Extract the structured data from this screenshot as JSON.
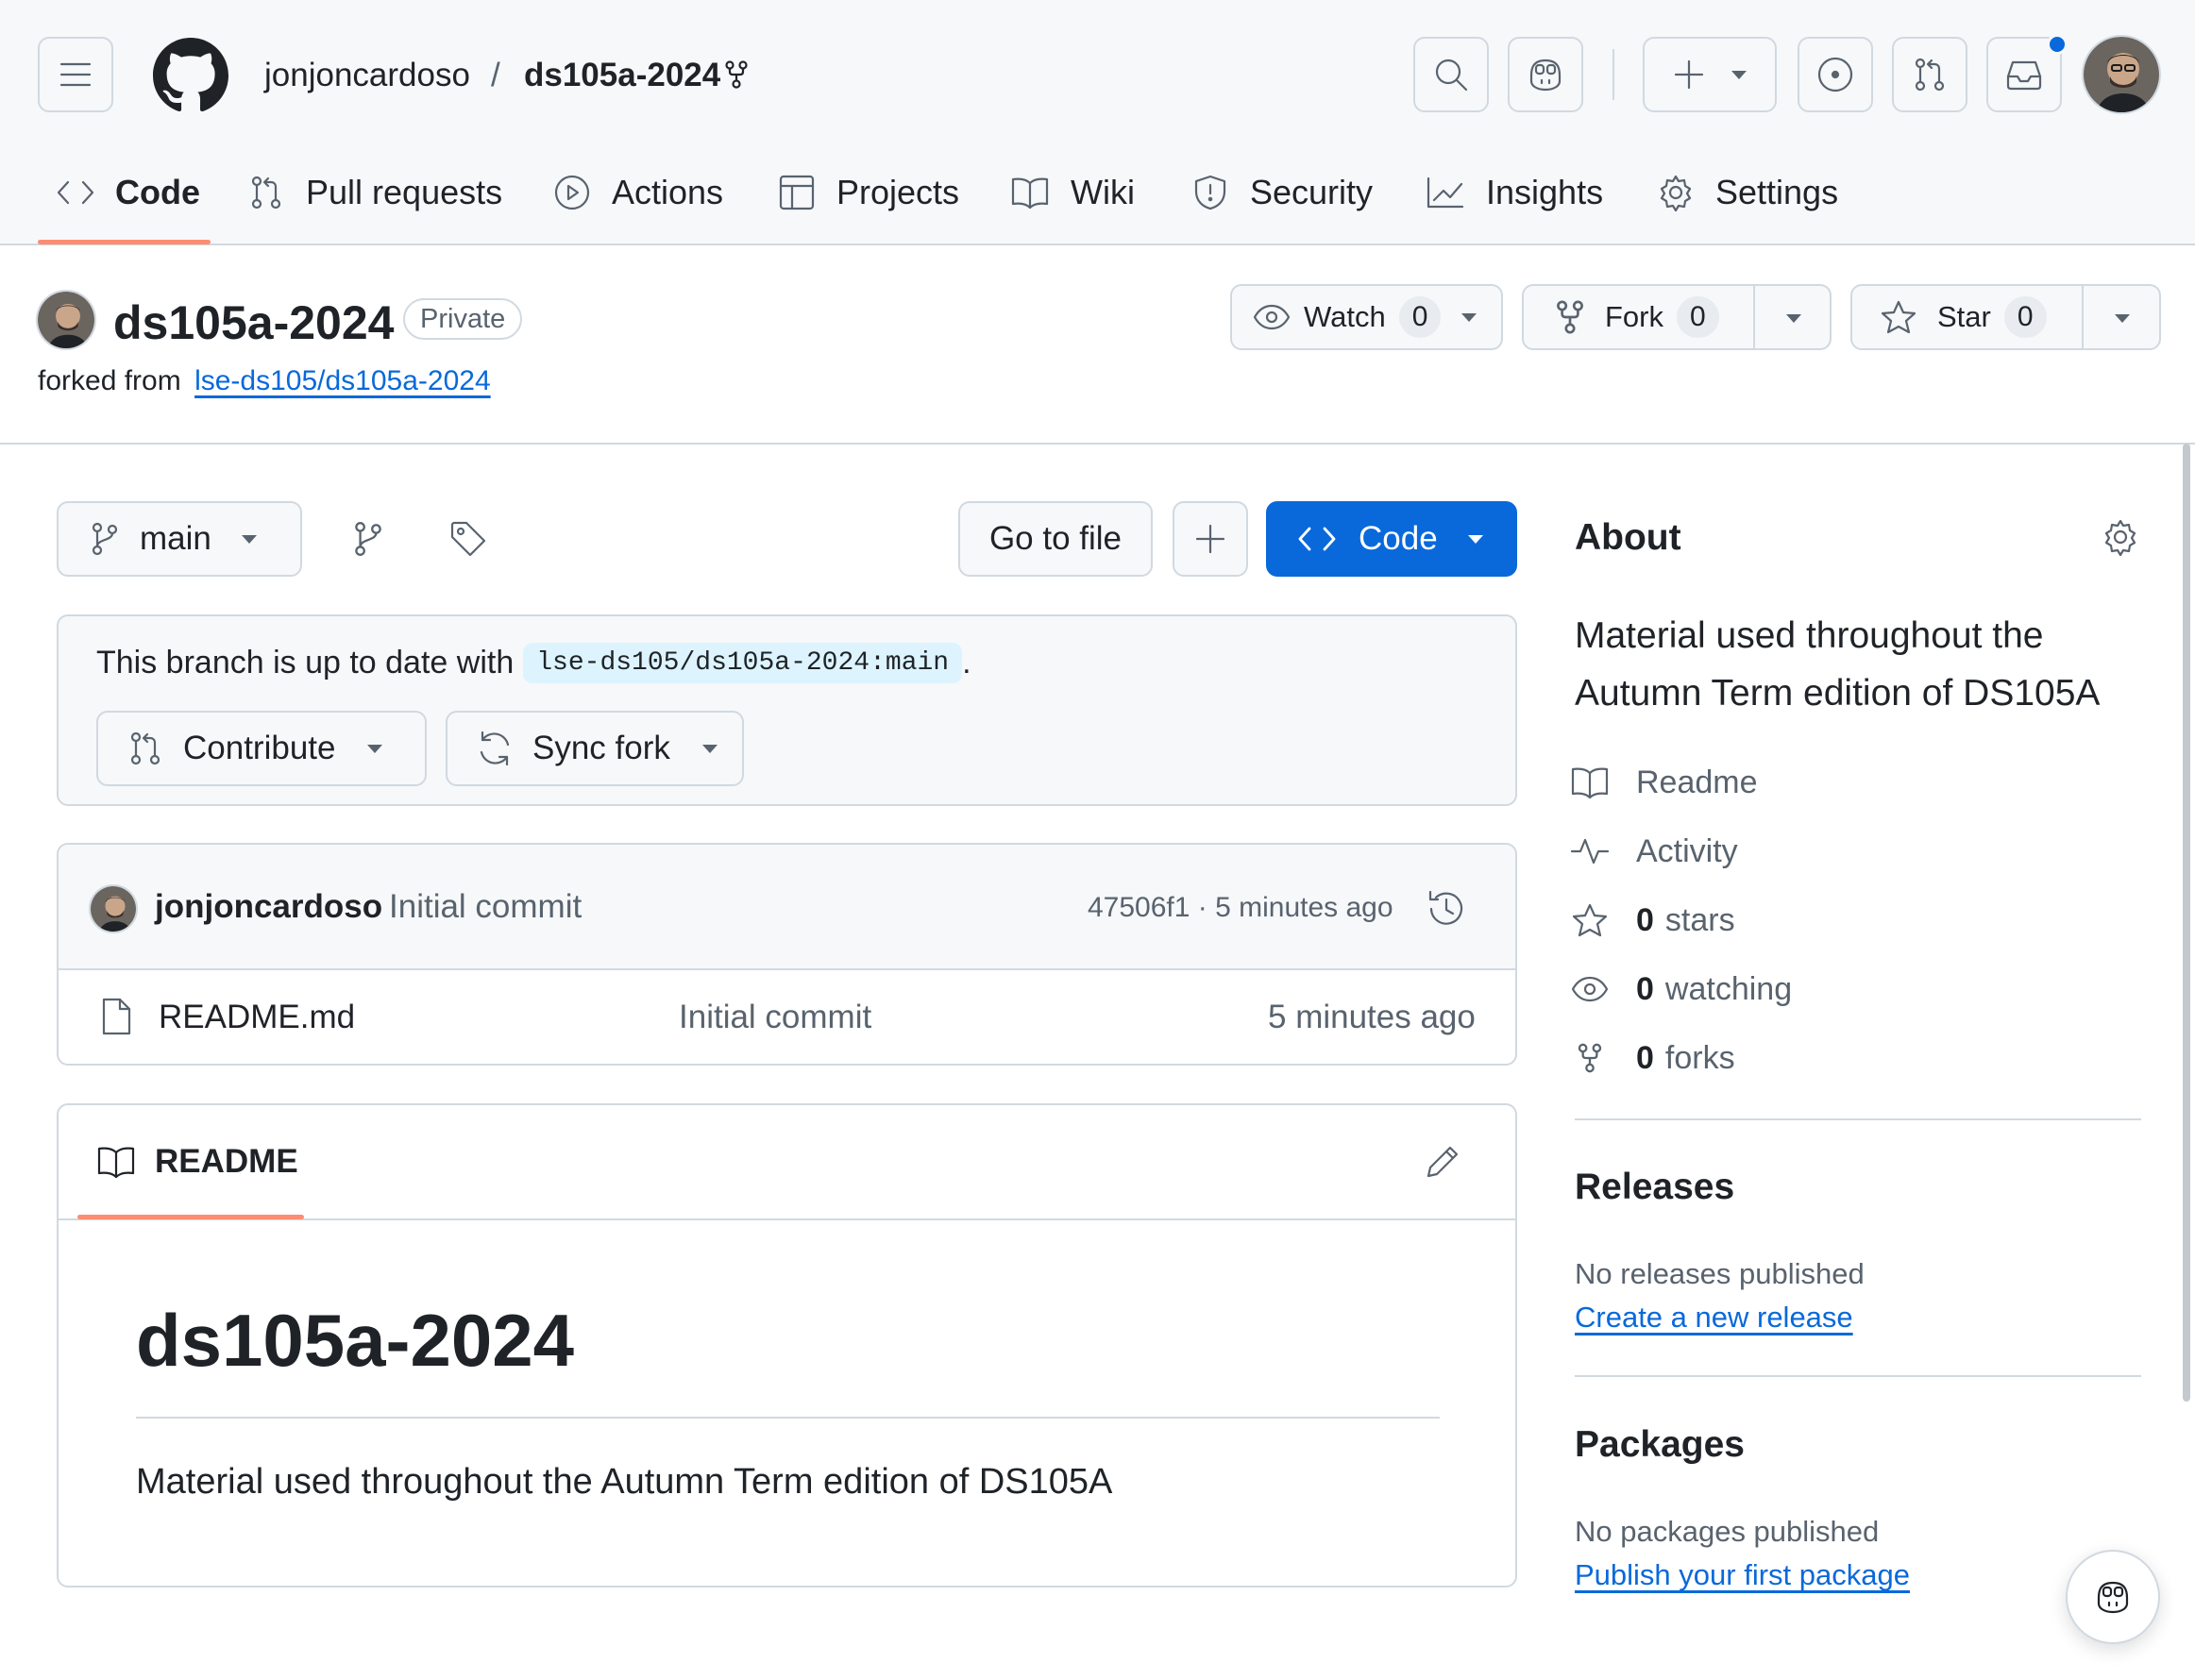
{
  "header": {
    "owner": "jonjoncardoso",
    "separator": "/",
    "repo": "ds105a-2024",
    "notifications_dot_color": "#0969da"
  },
  "tabs": [
    {
      "label": "Code",
      "icon": "code-icon",
      "active": true
    },
    {
      "label": "Pull requests",
      "icon": "pull-request-icon"
    },
    {
      "label": "Actions",
      "icon": "play-icon"
    },
    {
      "label": "Projects",
      "icon": "table-icon"
    },
    {
      "label": "Wiki",
      "icon": "book-icon"
    },
    {
      "label": "Security",
      "icon": "shield-icon"
    },
    {
      "label": "Insights",
      "icon": "graph-icon"
    },
    {
      "label": "Settings",
      "icon": "gear-icon"
    }
  ],
  "repo": {
    "name": "ds105a-2024",
    "visibility": "Private",
    "forked_from_prefix": "forked from",
    "forked_from": "lse-ds105/ds105a-2024",
    "watch_label": "Watch",
    "watch_count": "0",
    "fork_label": "Fork",
    "fork_count": "0",
    "star_label": "Star",
    "star_count": "0"
  },
  "toolbar": {
    "branch": "main",
    "go_to_file": "Go to file",
    "code_button": "Code"
  },
  "branch_status": {
    "text": "This branch is up to date with",
    "ref": "lse-ds105/ds105a-2024:main",
    "period": ".",
    "contribute": "Contribute",
    "sync_fork": "Sync fork"
  },
  "latest_commit": {
    "author": "jonjoncardoso",
    "message": "Initial commit",
    "sha_time": "47506f1 · 5 minutes ago"
  },
  "files": [
    {
      "name": "README.md",
      "message": "Initial commit",
      "time": "5 minutes ago"
    }
  ],
  "readme": {
    "tab_label": "README",
    "heading": "ds105a-2024",
    "body": "Material used throughout the Autumn Term edition of DS105A"
  },
  "about": {
    "title": "About",
    "description": "Material used throughout the Autumn Term edition of DS105A",
    "readme": "Readme",
    "activity": "Activity",
    "stars_count": "0",
    "stars_label": "stars",
    "watching_count": "0",
    "watching_label": "watching",
    "forks_count": "0",
    "forks_label": "forks"
  },
  "releases": {
    "title": "Releases",
    "empty": "No releases published",
    "link": "Create a new release"
  },
  "packages": {
    "title": "Packages",
    "empty": "No packages published",
    "link": "Publish your first package"
  },
  "colors": {
    "primary": "#0969da",
    "active_tab_underline": "#fd8c73",
    "border": "#d1d9e0"
  }
}
